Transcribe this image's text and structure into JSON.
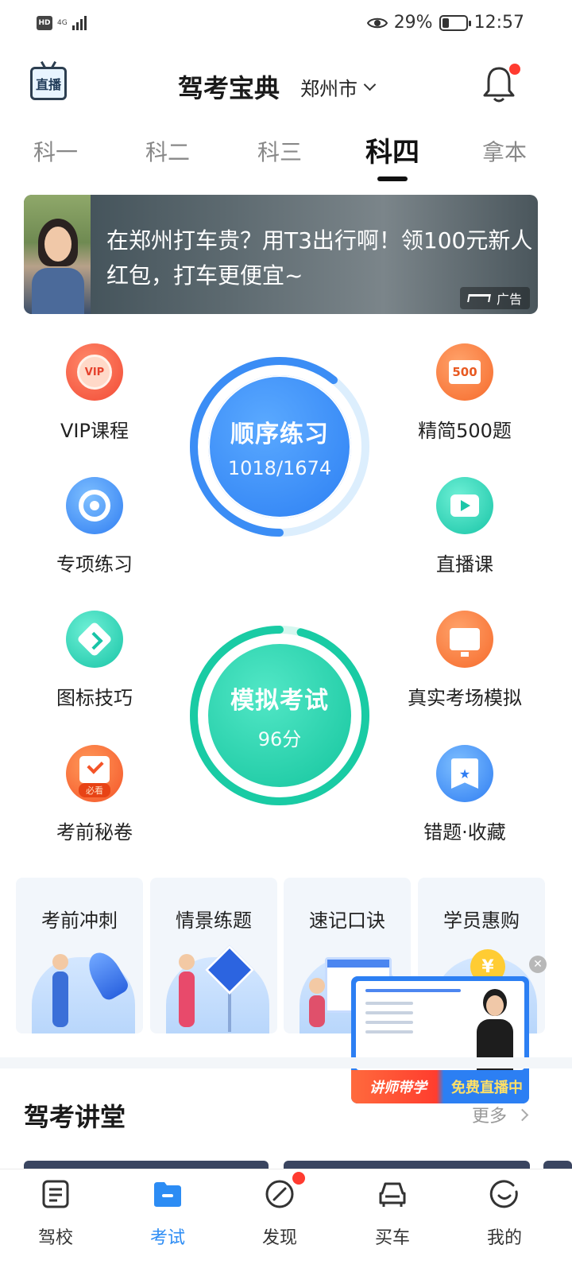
{
  "status_bar": {
    "network_badge": "HD",
    "network_type": "4G",
    "battery_percent": "29%",
    "battery_level": 0.29,
    "time": "12:57"
  },
  "header": {
    "live_label": "直播",
    "title": "驾考宝典",
    "city": "郑州市"
  },
  "tabs": [
    {
      "label": "科一",
      "active": false
    },
    {
      "label": "科二",
      "active": false
    },
    {
      "label": "科三",
      "active": false
    },
    {
      "label": "科四",
      "active": true
    },
    {
      "label": "拿本",
      "active": false
    }
  ],
  "ad": {
    "text": "在郑州打车贵？用T3出行啊！领100元新人红包，打车更便宜~",
    "badge": "广告"
  },
  "features": {
    "vip": "VIP课程",
    "vip_icon_text": "VIP",
    "simplified": "精简500题",
    "simplified_icon_text": "500",
    "special": "专项练习",
    "live_course": "直播课",
    "signs": "图标技巧",
    "real_exam": "真实考场模拟",
    "secret": "考前秘卷",
    "secret_icon_text": "必看",
    "mistakes": "错题·收藏"
  },
  "practice": {
    "title": "顺序练习",
    "progress": "1018/1674",
    "done": 1018,
    "total": 1674
  },
  "exam": {
    "title": "模拟考试",
    "score": "96分",
    "score_value": 96
  },
  "cards": [
    {
      "label": "考前冲刺"
    },
    {
      "label": "情景练题"
    },
    {
      "label": "速记口诀"
    },
    {
      "label": "学员惠购"
    }
  ],
  "float_live": {
    "left_text": "讲师带学",
    "right_text": "免费直播中"
  },
  "section": {
    "title": "驾考讲堂",
    "more": "更多"
  },
  "bottom_nav": [
    {
      "label": "驾校",
      "icon": "note-icon",
      "active": false
    },
    {
      "label": "考试",
      "icon": "folder-icon",
      "active": true
    },
    {
      "label": "发现",
      "icon": "compass-icon",
      "active": false
    },
    {
      "label": "买车",
      "icon": "car-icon",
      "active": false
    },
    {
      "label": "我的",
      "icon": "smile-icon",
      "active": false
    }
  ]
}
